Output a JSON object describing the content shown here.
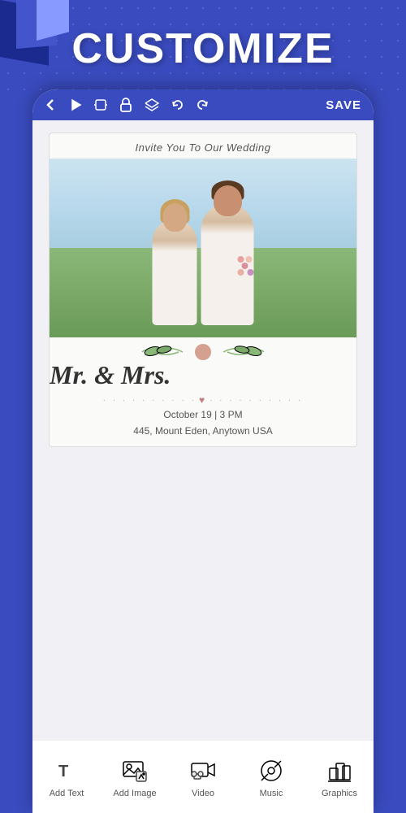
{
  "page": {
    "title": "CUSTOMIZE",
    "background_color": "#3a4bbf"
  },
  "toolbar": {
    "back_label": "<",
    "save_label": "SAVE",
    "icons": [
      "play",
      "phone-rotate",
      "lock",
      "layers",
      "undo",
      "redo"
    ]
  },
  "wedding_card": {
    "header_text": "Invite You To Our Wedding",
    "names": "Mr. & Mrs.",
    "date": "October 19 | 3 PM",
    "location": "445, Mount Eden, Anytown USA"
  },
  "bottom_nav": {
    "items": [
      {
        "id": "add-text",
        "label": "Add Text",
        "icon": "text-icon"
      },
      {
        "id": "add-image",
        "label": "Add Image",
        "icon": "image-icon"
      },
      {
        "id": "video",
        "label": "Video",
        "icon": "video-icon"
      },
      {
        "id": "music",
        "label": "Music",
        "icon": "music-icon"
      },
      {
        "id": "graphics",
        "label": "Graphics",
        "icon": "graphics-icon"
      }
    ]
  }
}
